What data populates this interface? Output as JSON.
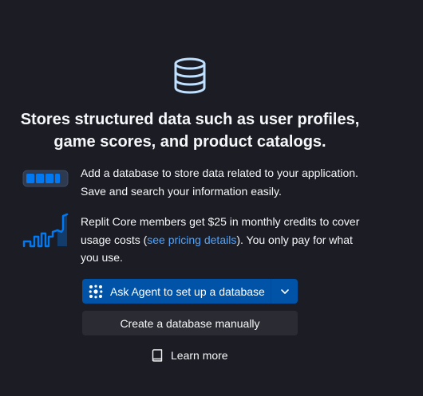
{
  "colors": {
    "background": "#1c1d24",
    "text": "#f5f7fa",
    "accent_link": "#4ea3ff",
    "primary_button": "#0053a6",
    "secondary_button": "#2b2c33",
    "illustration_blue": "#0079f2",
    "icon_stroke": "#bfe0ff"
  },
  "icons": {
    "header": "database-icon",
    "storage": "storage-bar-illustration",
    "usage": "usage-chart-illustration",
    "agent": "agent-icon",
    "dropdown": "chevron-down-icon",
    "learn_more": "book-icon"
  },
  "headline": "Stores structured data such as user profiles, game scores, and product catalogs.",
  "features": [
    {
      "text": "Add a database to store data related to your application. Save and search your information easily."
    },
    {
      "text_before": "Replit Core members get $25 in monthly credits to cover usage costs (",
      "link_text": "see pricing details",
      "text_after": "). You only pay for what you use."
    }
  ],
  "buttons": {
    "agent_label": "Ask Agent to set up a database",
    "manual_label": "Create a database manually",
    "learn_more_label": "Learn more"
  }
}
